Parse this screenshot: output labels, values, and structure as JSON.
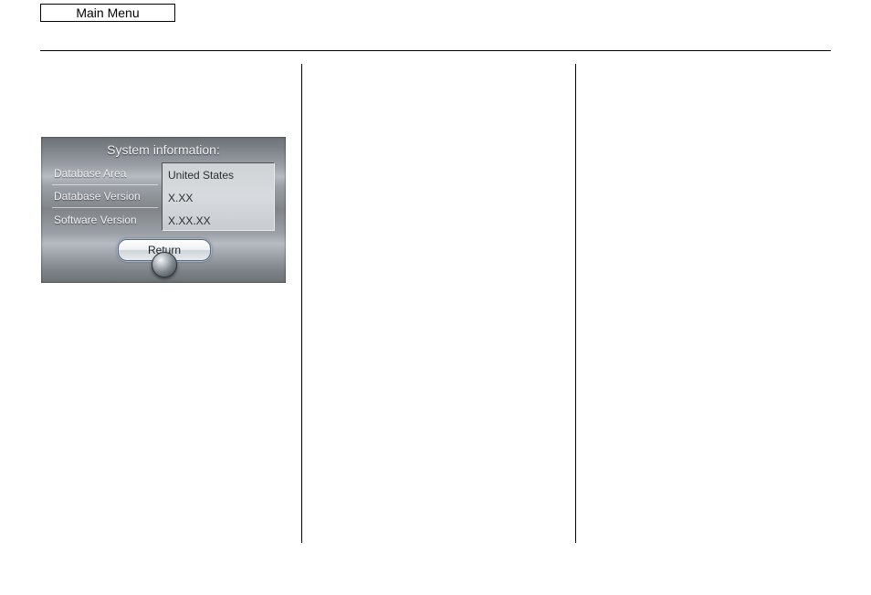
{
  "header": {
    "menu_button": "Main Menu"
  },
  "sysinfo": {
    "title": "System information:",
    "rows": [
      {
        "label": "Database Area",
        "value": "United States"
      },
      {
        "label": "Database Version",
        "value": "X.XX"
      },
      {
        "label": "Software Version",
        "value": "X.XX.XX"
      }
    ],
    "return_label": "Return"
  }
}
